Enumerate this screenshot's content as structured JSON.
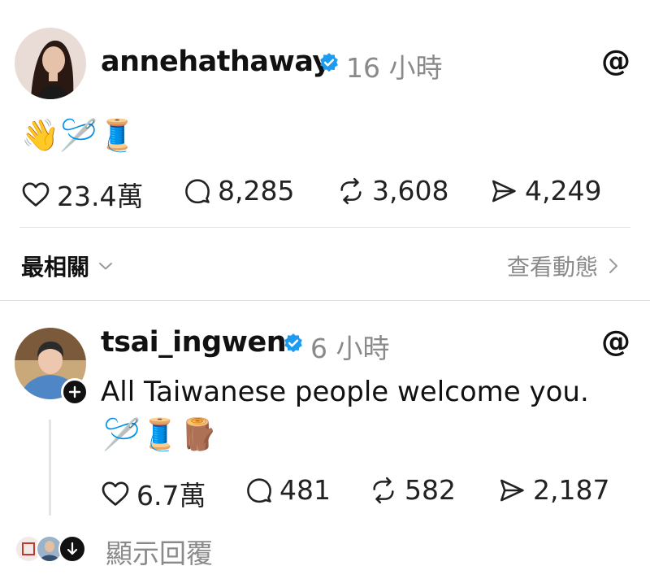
{
  "posts": [
    {
      "username": "annehathaway",
      "time": "16 小時",
      "content": "👋🪡🧵",
      "stats": {
        "likes": "23.4萬",
        "replies": "8,285",
        "reposts": "3,608",
        "shares": "4,249"
      }
    },
    {
      "username": "tsai_ingwen",
      "time": "6 小時",
      "text": "All Taiwanese people welcome you.",
      "content": "🪡🧵🪵",
      "stats": {
        "likes": "6.7萬",
        "replies": "481",
        "reposts": "582",
        "shares": "2,187"
      }
    }
  ],
  "filter": {
    "label": "最相關",
    "activity": "查看動態"
  },
  "show_replies": "顯示回覆",
  "threads_glyph": "@",
  "colors": {
    "verified": "#1d9bf0",
    "muted": "#8a8a8a",
    "divider": "#e2e2e2"
  }
}
